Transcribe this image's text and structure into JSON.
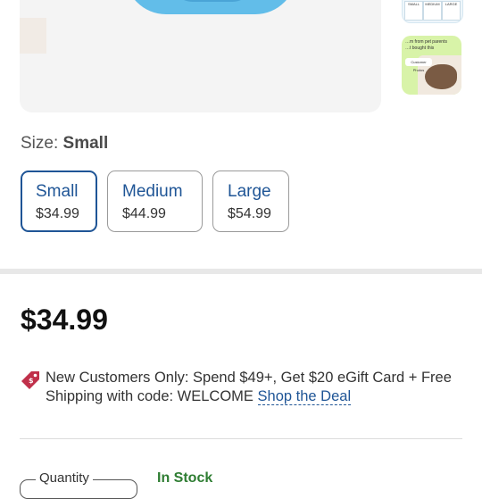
{
  "gallery": {
    "main_image_icon": "product-photo",
    "thumbs": [
      {
        "icon": "size-chart-thumbnail",
        "labels": [
          "SMALL",
          "MEDIUM",
          "LARGE"
        ]
      },
      {
        "icon": "customer-photos-thumbnail",
        "caption": "…m from pet parents",
        "sub": "…t bought this",
        "chip": "Customer Photos"
      }
    ]
  },
  "size": {
    "label": "Size:",
    "selected": "Small",
    "options": [
      {
        "name": "Small",
        "price": "$34.99"
      },
      {
        "name": "Medium",
        "price": "$44.99"
      },
      {
        "name": "Large",
        "price": "$54.99"
      }
    ]
  },
  "price": "$34.99",
  "promo": {
    "icon": "price-tag-icon",
    "text": "New Customers Only: Spend $49+, Get $20 eGift Card + Free Shipping with code: WELCOME",
    "link": "Shop the Deal"
  },
  "quantity": {
    "label": "Quantity"
  },
  "stock": "In Stock",
  "colors": {
    "accent": "#1f5596",
    "stock": "#2e7d32",
    "promo_icon": "#c0304a"
  }
}
